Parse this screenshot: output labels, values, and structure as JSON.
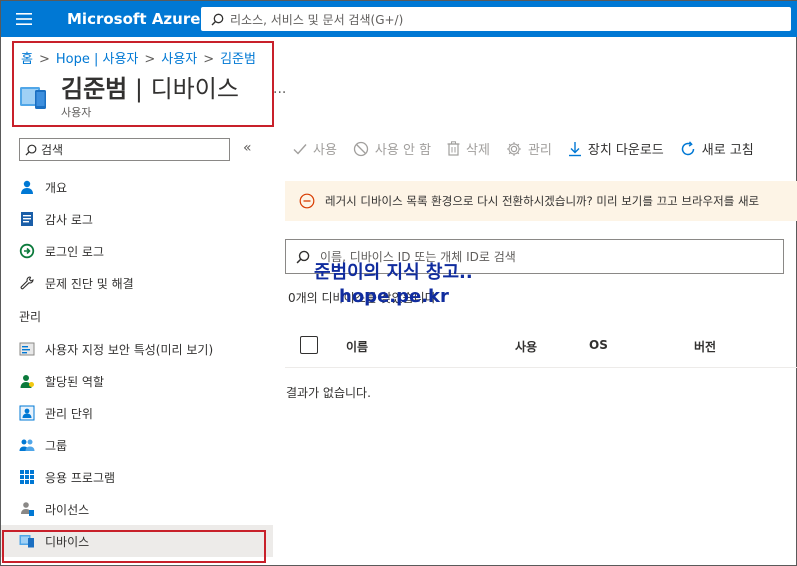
{
  "topbar": {
    "brand": "Microsoft Azure",
    "search_placeholder": "리소스, 서비스 및 문서 검색(G+/)",
    "accent_color": "#0078d4"
  },
  "breadcrumb": [
    "홈",
    "Hope | 사용자",
    "사용자",
    "김준범"
  ],
  "page": {
    "title_name": "김준범",
    "title_sep": " | ",
    "title_section": "디바이스",
    "subtitle": "사용자",
    "more": "..."
  },
  "sidebar": {
    "search_value": "검색",
    "collapse": "«",
    "items_top": [
      {
        "label": "개요",
        "icon": "user-icon"
      },
      {
        "label": "감사 로그",
        "icon": "audit-log-icon"
      },
      {
        "label": "로그인 로그",
        "icon": "signin-log-icon"
      },
      {
        "label": "문제 진단 및 해결",
        "icon": "wrench-icon"
      }
    ],
    "section_manage": "관리",
    "items_manage": [
      {
        "label": "사용자 지정 보안 특성(미리 보기)",
        "icon": "security-attributes-icon"
      },
      {
        "label": "할당된 역할",
        "icon": "roles-icon"
      },
      {
        "label": "관리 단위",
        "icon": "admin-units-icon"
      },
      {
        "label": "그룹",
        "icon": "groups-icon"
      },
      {
        "label": "응용 프로그램",
        "icon": "apps-grid-icon"
      },
      {
        "label": "라이선스",
        "icon": "license-icon"
      },
      {
        "label": "디바이스",
        "icon": "device-icon"
      }
    ]
  },
  "toolbar": {
    "enable": "사용",
    "disable": "사용 안 함",
    "delete": "삭제",
    "manage": "관리",
    "download": "장치 다운로드",
    "refresh": "새로 고침"
  },
  "banner": {
    "text": "레거시 디바이스 목록 환경으로 다시 전환하시겠습니까? 미리 보기를 끄고 브라우저를 새로"
  },
  "device_search": {
    "placeholder": "이름, 디바이스 ID 또는 개체 ID로 검색"
  },
  "count_text": "0개의 디바이스를 찾았습니다",
  "table": {
    "columns": [
      "이름",
      "사용",
      "OS",
      "버전"
    ],
    "empty": "결과가 없습니다."
  },
  "watermark": {
    "line1": "준범이의 지식 창고..",
    "line2": "hope.pe.kr"
  }
}
